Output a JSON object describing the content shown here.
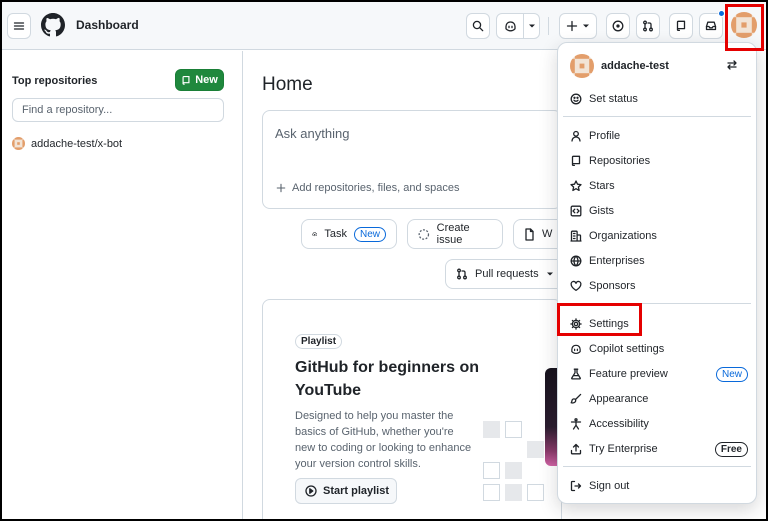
{
  "header": {
    "title": "Dashboard"
  },
  "sidebar": {
    "heading": "Top repositories",
    "new_label": "New",
    "find_placeholder": "Find a repository...",
    "repos": [
      {
        "name": "addache-test/x-bot"
      }
    ]
  },
  "main": {
    "title": "Home",
    "ask_placeholder": "Ask anything",
    "add_context": "Add repositories, files, and spaces",
    "chips": {
      "task": "Task",
      "task_badge": "New",
      "create_issue": "Create issue",
      "w": "W",
      "pull_requests": "Pull requests"
    },
    "playlist": {
      "label": "Playlist",
      "title": "GitHub for beginners on YouTube",
      "description": "Designed to help you master the basics of GitHub, whether you're new to coding or looking to enhance your version control skills.",
      "button": "Start playlist"
    }
  },
  "menu": {
    "username": "addache-test",
    "items": [
      {
        "label": "Set status",
        "icon": "smiley-icon"
      },
      {
        "label": "Profile",
        "icon": "person-icon"
      },
      {
        "label": "Repositories",
        "icon": "repo-icon"
      },
      {
        "label": "Stars",
        "icon": "star-icon"
      },
      {
        "label": "Gists",
        "icon": "code-square-icon"
      },
      {
        "label": "Organizations",
        "icon": "organization-icon"
      },
      {
        "label": "Enterprises",
        "icon": "globe-icon"
      },
      {
        "label": "Sponsors",
        "icon": "heart-icon"
      },
      {
        "label": "Settings",
        "icon": "gear-icon"
      },
      {
        "label": "Copilot settings",
        "icon": "copilot-icon"
      },
      {
        "label": "Feature preview",
        "icon": "beaker-icon",
        "badge": "New"
      },
      {
        "label": "Appearance",
        "icon": "paintbrush-icon"
      },
      {
        "label": "Accessibility",
        "icon": "accessibility-icon"
      },
      {
        "label": "Try Enterprise",
        "icon": "upload-icon",
        "badge": "Free"
      },
      {
        "label": "Sign out",
        "icon": "sign-out-icon"
      }
    ]
  },
  "colors": {
    "primary_green": "#1f883d",
    "accent_blue": "#0969da",
    "highlight_red": "#e50000",
    "border": "#d1d9e0"
  }
}
